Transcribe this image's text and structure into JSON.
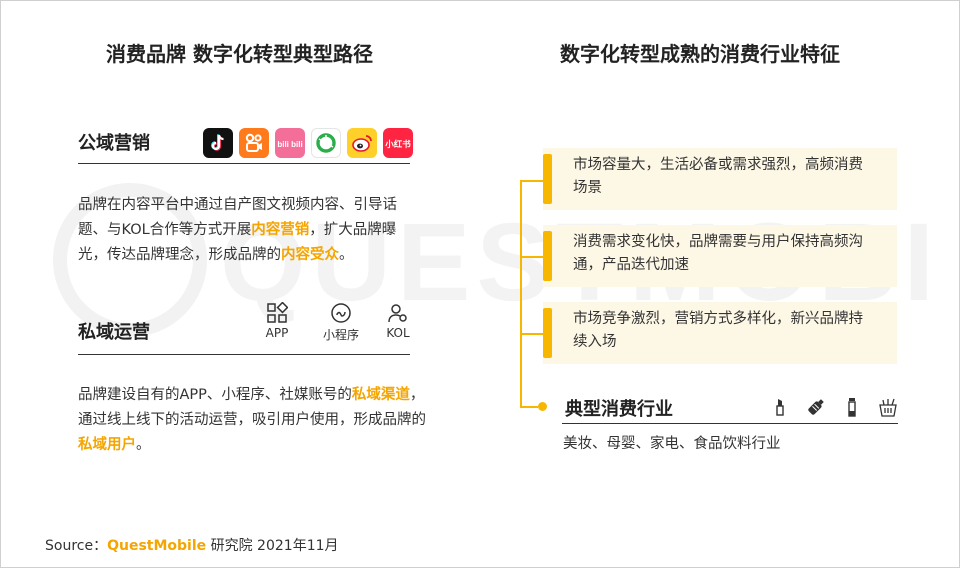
{
  "left_title": "消费品牌 数字化转型典型路径",
  "right_title": "数字化转型成熟的消费行业特征",
  "public": {
    "label": "公域营销",
    "apps": [
      "douyin-icon",
      "kuaishou-icon",
      "bilibili-icon",
      "wechat-moments-icon",
      "weibo-icon",
      "xiaohongshu-icon"
    ],
    "bilibili_text": "bili bili",
    "xiaohongshu_text": "小红书",
    "text_1": "品牌在内容平台中通过自产图文视频内容、引导话题、与KOL合作等方式开展",
    "hl_1": "内容营销",
    "text_2": "，扩大品牌曝光，传达品牌理念，形成品牌的",
    "hl_2": "内容受众",
    "text_3": "。"
  },
  "private": {
    "label": "私域运营",
    "icons": [
      {
        "icon": "app-grid-icon",
        "label": "APP"
      },
      {
        "icon": "mini-program-icon",
        "label": "小程序"
      },
      {
        "icon": "kol-user-icon",
        "label": "KOL"
      }
    ],
    "text_1": "品牌建设自有的APP、小程序、社媒账号的",
    "hl_1": "私域渠道",
    "text_2": "，通过线上线下的活动运营，吸引用户使用，形成品牌的",
    "hl_2": "私域用户",
    "text_3": "。"
  },
  "features": [
    "市场容量大，生活必备或需求强烈，高频消费场景",
    "消费需求变化快，品牌需要与用户保持高频沟通，产品迭代加速",
    "市场竞争激烈，营销方式多样化，新兴品牌持续入场"
  ],
  "industry": {
    "label": "典型消费行业",
    "icons": [
      "lipstick-icon",
      "baby-bottle-icon",
      "appliance-icon",
      "food-drink-icon"
    ],
    "text": "美妆、母婴、家电、食品饮料行业"
  },
  "source": {
    "prefix": "Source：",
    "brand": "QuestMobile",
    "suffix": "研究院 2021年11月"
  },
  "watermark": "QUESTMOBILE",
  "colors": {
    "accent": "#f7b700",
    "highlight": "#f5a500",
    "card_bg": "#fdf7e6"
  }
}
